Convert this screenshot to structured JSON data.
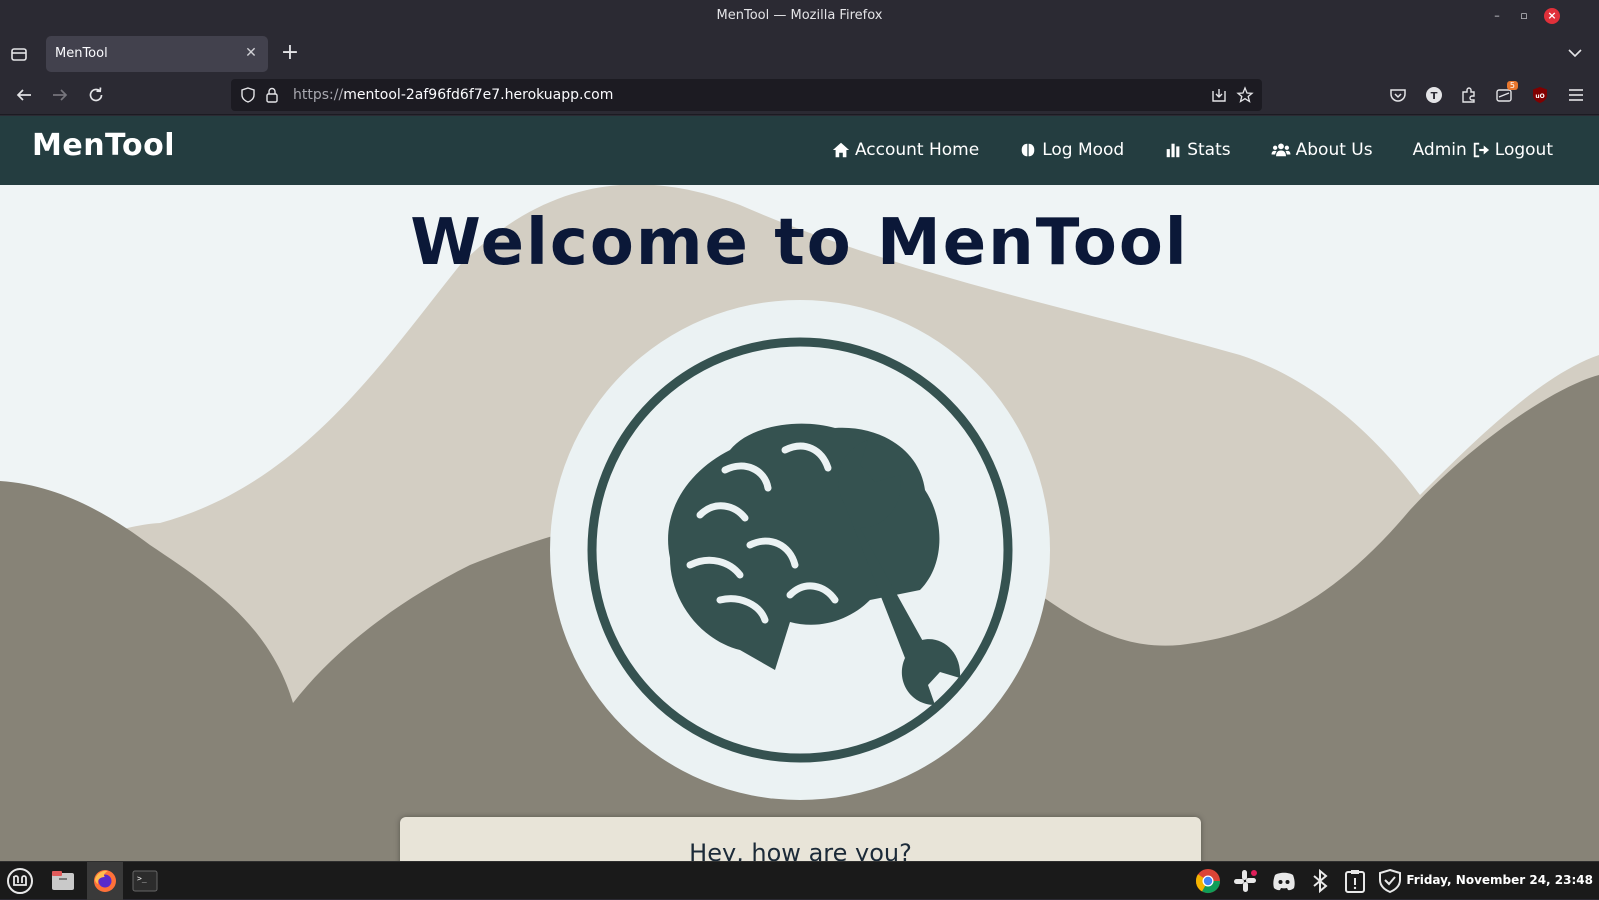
{
  "window": {
    "title": "MenTool — Mozilla Firefox"
  },
  "browser": {
    "tab_title": "MenTool",
    "url_scheme": "https://",
    "url_host": "mentool-2af96fd6f7e7.herokuapp.com",
    "extension_badge": "5"
  },
  "site": {
    "brand": "MenTool",
    "nav": [
      {
        "label": "Account Home",
        "icon": "home-icon"
      },
      {
        "label": "Log Mood",
        "icon": "brain-icon"
      },
      {
        "label": "Stats",
        "icon": "bar-chart-icon"
      },
      {
        "label": "About Us",
        "icon": "users-icon"
      },
      {
        "label": "Admin",
        "icon": ""
      },
      {
        "label": "Logout",
        "icon": "logout-icon"
      }
    ],
    "hero_title": "Welcome to MenTool",
    "mood_question": "Hey, how are you?",
    "colors": {
      "header": "#243d40",
      "logo": "#355250",
      "hero_text": "#0b1838",
      "wave_light": "#d3cec3",
      "wave_dark": "#878377"
    }
  },
  "taskbar": {
    "clock": "Friday, November 24, 23:48",
    "apps": [
      "mint-menu-icon",
      "files-icon",
      "firefox-icon",
      "terminal-icon"
    ],
    "tray": [
      "chrome-icon",
      "slack-icon",
      "discord-icon",
      "bluetooth-icon",
      "clipboard-icon",
      "shield-icon"
    ]
  }
}
